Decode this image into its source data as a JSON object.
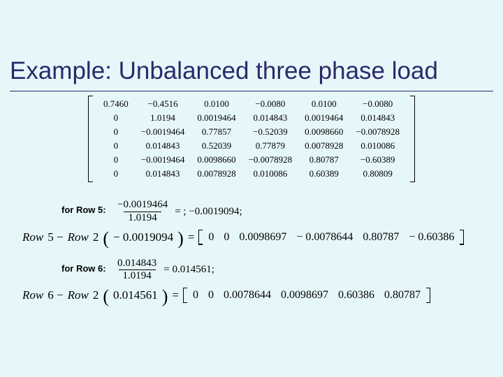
{
  "title": "Example: Unbalanced three phase load",
  "matrix": {
    "rows": [
      [
        "0.7460",
        "−0.4516",
        "0.0100",
        "−0.0080",
        "0.0100",
        "−0.0080"
      ],
      [
        "0",
        "1.0194",
        "0.0019464",
        "0.014843",
        "0.0019464",
        "0.014843"
      ],
      [
        "0",
        "−0.0019464",
        "0.77857",
        "−0.52039",
        "0.0098660",
        "−0.0078928"
      ],
      [
        "0",
        "0.014843",
        "0.52039",
        "0.77879",
        "0.0078928",
        "0.010086"
      ],
      [
        "0",
        "−0.0019464",
        "0.0098660",
        "−0.0078928",
        "0.80787",
        "−0.60389"
      ],
      [
        "0",
        "0.014843",
        "0.0078928",
        "0.010086",
        "0.60389",
        "0.80809"
      ]
    ]
  },
  "row5": {
    "label": "for Row 5:",
    "frac_num": "−0.0019464",
    "frac_den": "1.0194",
    "frac_eq": "= ; −0.0019094;",
    "eq_lhs_a": "Row",
    "eq_lhs_b": "5 −",
    "eq_lhs_c": "Row",
    "eq_lhs_d": "2",
    "factor": "− 0.0019094",
    "equals": "=",
    "vec": [
      "0",
      "0",
      "0.0098697",
      "− 0.0078644",
      "0.80787",
      "− 0.60386"
    ]
  },
  "row6": {
    "label": "for Row 6:",
    "frac_num": "0.014843",
    "frac_den": "1.0194",
    "frac_eq": "= 0.014561;",
    "eq_lhs_a": "Row",
    "eq_lhs_b": "6 −",
    "eq_lhs_c": "Row",
    "eq_lhs_d": "2",
    "factor": "0.014561",
    "equals": "=",
    "vec": [
      "0",
      "0",
      "0.0078644",
      "0.0098697",
      "0.60386",
      "0.80787"
    ]
  }
}
